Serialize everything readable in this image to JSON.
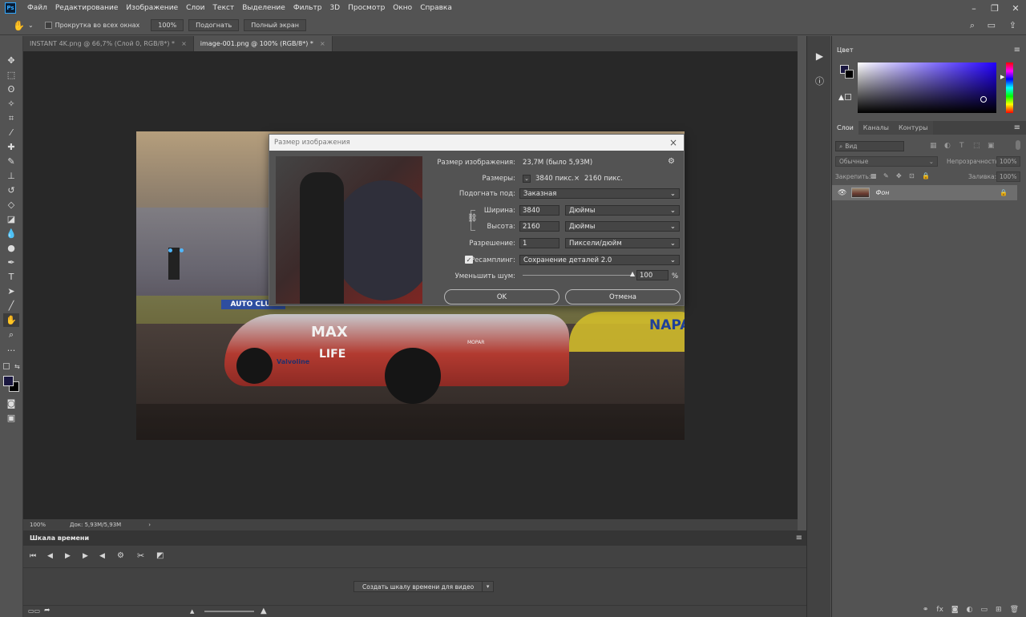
{
  "app": {
    "logo": "Ps"
  },
  "menu": [
    "Файл",
    "Редактирование",
    "Изображение",
    "Слои",
    "Текст",
    "Выделение",
    "Фильтр",
    "3D",
    "Просмотр",
    "Окно",
    "Справка"
  ],
  "options": {
    "scroll_all": "Прокрутка во всех окнах",
    "zoom100": "100%",
    "fit": "Подогнать",
    "fullscreen": "Полный экран"
  },
  "tabs": [
    {
      "label": "INSTANT 4K.png @ 66,7% (Слой 0, RGB/8*) *",
      "close": "×"
    },
    {
      "label": "image-001.png @ 100% (RGB/8*) *",
      "close": "×"
    }
  ],
  "image_text": {
    "max": "MAX",
    "life": "LIFE",
    "valvoline": "Valvoline",
    "autoclub": "AUTO CLUB",
    "nap": "NAPA",
    "mopar": "MOPAR"
  },
  "status": {
    "zoom": "100%",
    "doc": "Док: 5,93M/5,93M",
    "arrow": "›"
  },
  "timeline": {
    "title": "Шкала времени",
    "create_button": "Создать шкалу времени для видео",
    "dropdown": "▾"
  },
  "panels": {
    "color_tab": "Цвет",
    "layers_tabs": [
      "Слои",
      "Каналы",
      "Контуры"
    ],
    "search_placeholder": "Вид",
    "blend_mode": "Обычные",
    "opacity_label": "Непрозрачность:",
    "opacity_value": "100%",
    "lock_label": "Закрепить:",
    "fill_label": "Заливка:",
    "fill_value": "100%",
    "layer_name": "Фон"
  },
  "colors": {
    "foreground": "#1a1740",
    "background": "#000000",
    "picker_hue": "#2200ff"
  },
  "dialog": {
    "title": "Размер изображения",
    "close": "×",
    "size_label": "Размер изображения:",
    "size_value": "23,7M (было 5,93M)",
    "dims_label": "Размеры:",
    "dims_width": "3840 пикс.",
    "dims_x": "×",
    "dims_height": "2160 пикс.",
    "fit_label": "Подогнать под:",
    "fit_value": "Заказная",
    "width_label": "Ширина:",
    "width_value": "3840",
    "width_unit": "Дюймы",
    "height_label": "Высота:",
    "height_value": "2160",
    "height_unit": "Дюймы",
    "res_label": "Разрешение:",
    "res_value": "1",
    "res_unit": "Пиксели/дюйм",
    "resample_label": "Ресамплинг:",
    "resample_value": "Сохранение деталей 2.0",
    "noise_label": "Уменьшить шум:",
    "noise_value": "100",
    "noise_unit": "%",
    "noise_level": 1.0,
    "ok": "OK",
    "cancel": "Отмена"
  }
}
